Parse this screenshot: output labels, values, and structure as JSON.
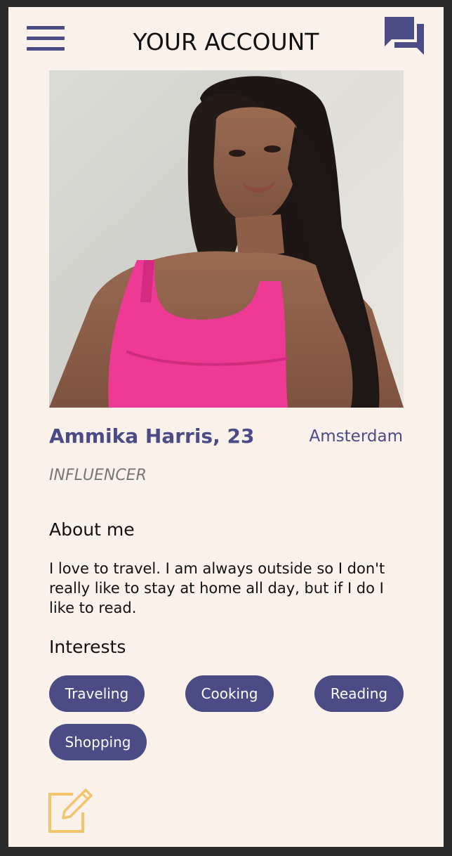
{
  "header": {
    "title": "YOUR ACCOUNT"
  },
  "icons": {
    "menu": "hamburger-menu-icon",
    "chat": "chat-bubbles-icon",
    "edit": "edit-pencil-icon"
  },
  "profile": {
    "name": "Ammika Harris, 23",
    "city": "Amsterdam",
    "occupation": "INFLUENCER"
  },
  "about": {
    "title": "About me",
    "text": "I love to travel. I am always outside so I don't really like to stay at home all day, but if I do I like to read."
  },
  "interests": {
    "title": "Interests",
    "items": [
      "Traveling",
      "Cooking",
      "Reading",
      "Shopping"
    ]
  },
  "colors": {
    "accent": "#4b4b86",
    "background": "#f9f1ea",
    "edit_icon": "#f2c46b"
  }
}
